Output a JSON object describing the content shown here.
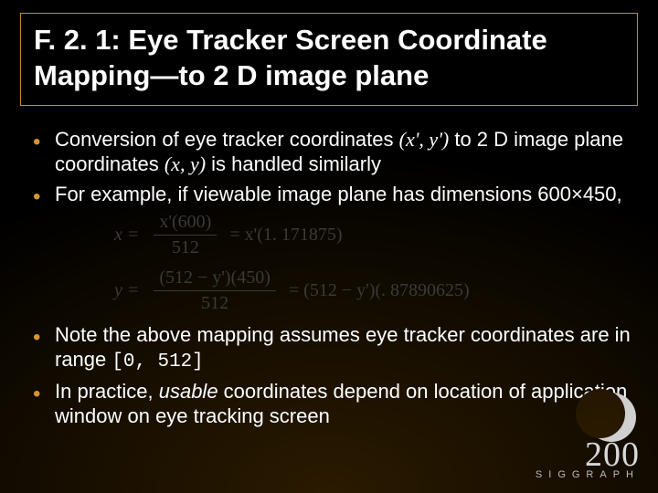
{
  "title": "F. 2. 1: Eye Tracker Screen Coordinate Mapping—to 2 D image plane",
  "bullets": {
    "b1_pre": "Conversion of eye tracker coordinates ",
    "b1_coord1": "(x', y')",
    "b1_mid": " to 2 D image plane coordinates ",
    "b1_coord2": "(x, y)",
    "b1_post": " is handled similarly",
    "b2": "For example, if viewable image plane has dimensions 600×450,",
    "b3_pre": "Note the above mapping assumes eye tracker coordinates are in range ",
    "b3_range": "[0, 512]",
    "b4_pre": "In practice, ",
    "b4_em": "usable",
    "b4_post": " coordinates depend on location of application window on eye tracking screen"
  },
  "eq": {
    "x_lhs": "x =",
    "x_num": "x'(600)",
    "x_den": "512",
    "x_rhs": "= x'(1. 171875)",
    "y_lhs": "y =",
    "y_num": "(512 − y')(450)",
    "y_den": "512",
    "y_rhs": "= (512 − y')(. 87890625)"
  },
  "logo": {
    "year": "200",
    "sig": "SIGGRAPH"
  }
}
